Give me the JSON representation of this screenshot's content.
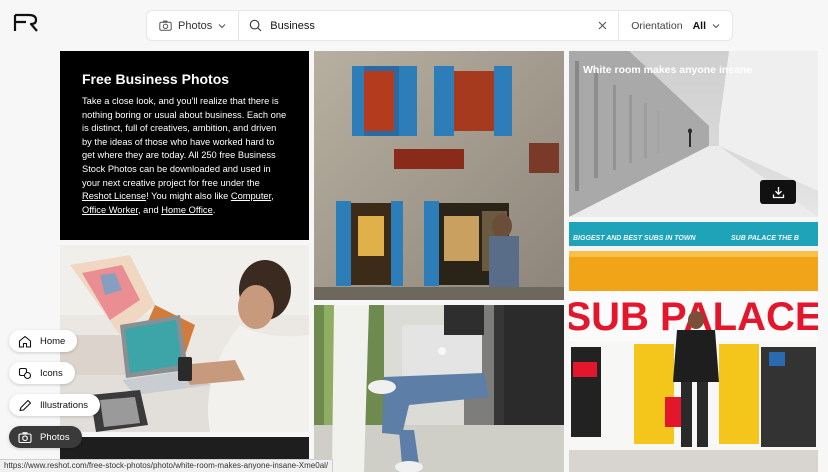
{
  "search": {
    "type_label": "Photos",
    "query": "Business",
    "orientation_label": "Orientation",
    "orientation_value": "All"
  },
  "intro": {
    "title": "Free Business Photos",
    "body_start": "Take a close look, and you'll realize that there is nothing boring or usual about business. Each one is distinct, full of creatives, ambition, and driven by the ideas of those who have worked hard to get where they are today. All 250 free Business Stock Photos can be downloaded and used in your next creative project for free under the ",
    "license_link": "Reshot License",
    "body_mid": "! You might also like ",
    "link_computer": "Computer",
    "sep1": ", ",
    "link_office_worker": "Office Worker",
    "sep2": ", and ",
    "link_home_office": "Home Office",
    "body_end": "."
  },
  "photos": {
    "white_room_title": "White room makes anyone insane"
  },
  "sign": {
    "top_text_left": "BIGGEST AND BEST SUBS IN TOWN",
    "top_text_right": "SUB PALACE   THE B",
    "big_text": "SUB PALACE"
  },
  "nav": {
    "home": "Home",
    "icons": "Icons",
    "illustrations": "Illustrations",
    "photos": "Photos"
  },
  "status_url": "https://www.reshot.com/free-stock-photos/photo/white-room-makes-anyone-insane-Xme0al/",
  "icons": [
    "logo-icon",
    "camera-icon",
    "chevron-down-icon",
    "search-icon",
    "close-icon",
    "download-icon",
    "home-icon",
    "icons-icon",
    "pencil-icon"
  ]
}
